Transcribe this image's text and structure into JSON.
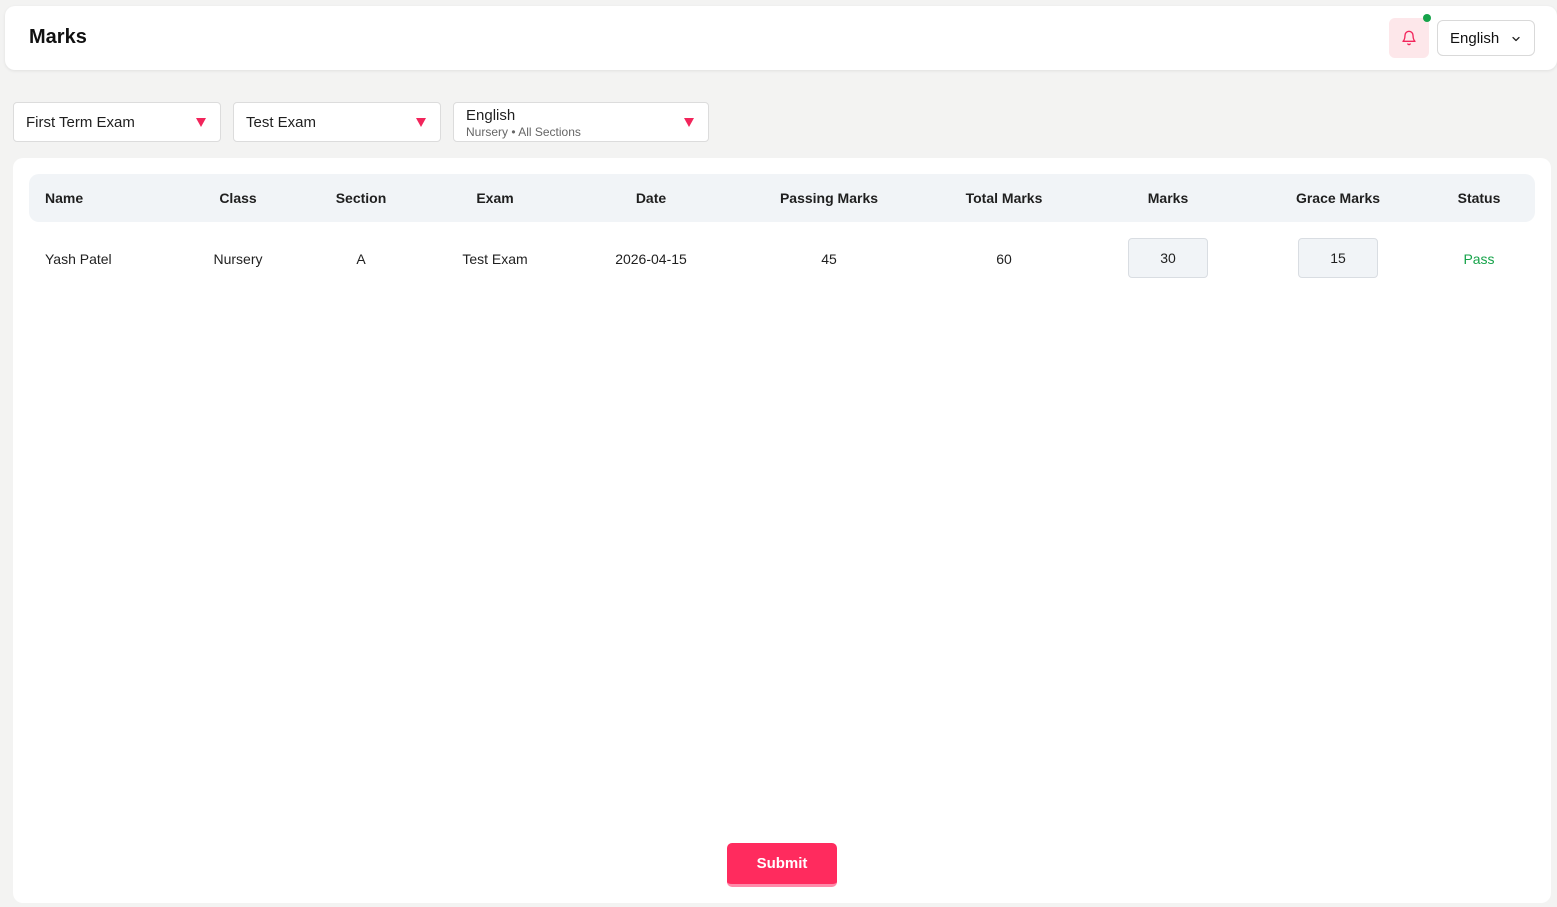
{
  "header": {
    "title": "Marks",
    "notification_icon": "bell-icon",
    "notification_dot_color": "#16a34a",
    "language": "English"
  },
  "filters": {
    "term": "First Term Exam",
    "exam": "Test Exam",
    "subject": "English",
    "subject_subtitle": "Nursery • All Sections",
    "accent_color": "#f2255b"
  },
  "table": {
    "columns": [
      "Name",
      "Class",
      "Section",
      "Exam",
      "Date",
      "Passing Marks",
      "Total Marks",
      "Marks",
      "Grace Marks",
      "Status"
    ],
    "rows": [
      {
        "name": "Yash Patel",
        "class": "Nursery",
        "section": "A",
        "exam": "Test Exam",
        "date": "2026-04-15",
        "passing_marks": "45",
        "total_marks": "60",
        "marks": "30",
        "grace_marks": "15",
        "status": "Pass"
      }
    ]
  },
  "actions": {
    "submit_label": "Submit",
    "submit_color": "#ff2b5e"
  }
}
